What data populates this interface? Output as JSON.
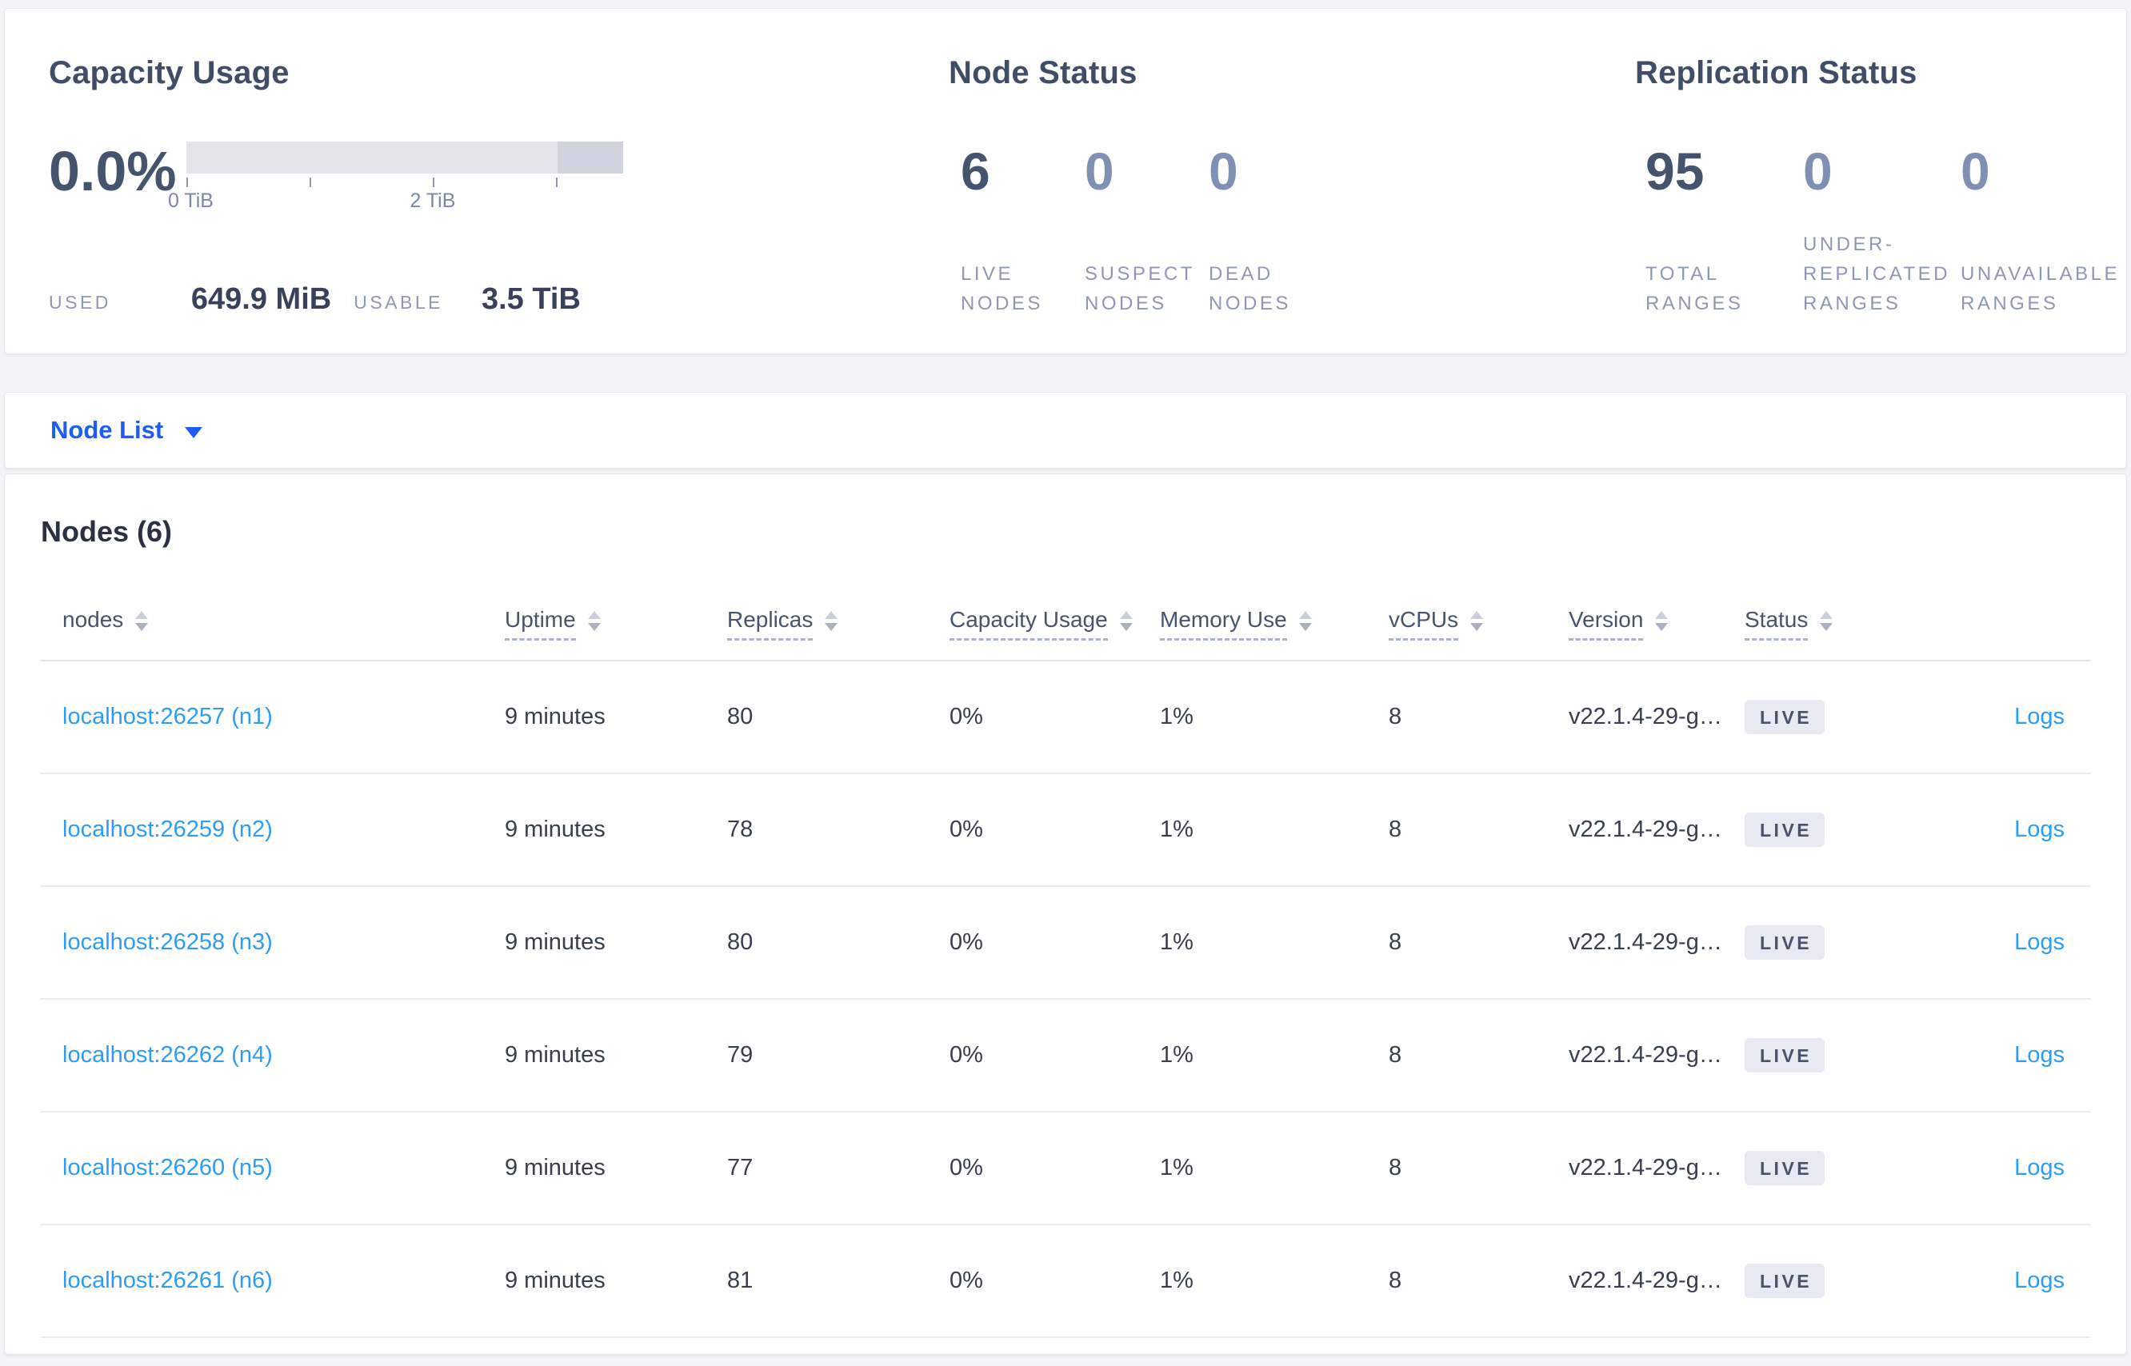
{
  "summary": {
    "capacity": {
      "title": "Capacity Usage",
      "percent": "0.0%",
      "tick_labels": [
        "0 TiB",
        "2 TiB"
      ],
      "used_label": "USED",
      "used_value": "649.9 MiB",
      "usable_label": "USABLE",
      "usable_value": "3.5 TiB"
    },
    "node_status": {
      "title": "Node Status",
      "metrics": [
        {
          "value": "6",
          "label": "LIVE NODES",
          "muted": false
        },
        {
          "value": "0",
          "label": "SUSPECT NODES",
          "muted": true
        },
        {
          "value": "0",
          "label": "DEAD NODES",
          "muted": true
        }
      ]
    },
    "replication_status": {
      "title": "Replication Status",
      "metrics": [
        {
          "value": "95",
          "label": "TOTAL RANGES",
          "muted": false
        },
        {
          "value": "0",
          "label": "UNDER-REPLICATED RANGES",
          "muted": true
        },
        {
          "value": "0",
          "label": "UNAVAILABLE RANGES",
          "muted": true
        }
      ]
    }
  },
  "view_selector": {
    "label": "Node List"
  },
  "nodes_table": {
    "title": "Nodes (6)",
    "columns": [
      {
        "label": "nodes",
        "underlined": false
      },
      {
        "label": "Uptime",
        "underlined": true
      },
      {
        "label": "Replicas",
        "underlined": true
      },
      {
        "label": "Capacity Usage",
        "underlined": true
      },
      {
        "label": "Memory Use",
        "underlined": true
      },
      {
        "label": "vCPUs",
        "underlined": true
      },
      {
        "label": "Version",
        "underlined": true
      },
      {
        "label": "Status",
        "underlined": true
      }
    ],
    "logs_label": "Logs",
    "rows": [
      {
        "address": "localhost:26257 (n1)",
        "uptime": "9 minutes",
        "replicas": "80",
        "capacity_usage": "0%",
        "memory_use": "1%",
        "vcpus": "8",
        "version": "v22.1.4-29-g…",
        "status": "LIVE"
      },
      {
        "address": "localhost:26259 (n2)",
        "uptime": "9 minutes",
        "replicas": "78",
        "capacity_usage": "0%",
        "memory_use": "1%",
        "vcpus": "8",
        "version": "v22.1.4-29-g…",
        "status": "LIVE"
      },
      {
        "address": "localhost:26258 (n3)",
        "uptime": "9 minutes",
        "replicas": "80",
        "capacity_usage": "0%",
        "memory_use": "1%",
        "vcpus": "8",
        "version": "v22.1.4-29-g…",
        "status": "LIVE"
      },
      {
        "address": "localhost:26262 (n4)",
        "uptime": "9 minutes",
        "replicas": "79",
        "capacity_usage": "0%",
        "memory_use": "1%",
        "vcpus": "8",
        "version": "v22.1.4-29-g…",
        "status": "LIVE"
      },
      {
        "address": "localhost:26260 (n5)",
        "uptime": "9 minutes",
        "replicas": "77",
        "capacity_usage": "0%",
        "memory_use": "1%",
        "vcpus": "8",
        "version": "v22.1.4-29-g…",
        "status": "LIVE"
      },
      {
        "address": "localhost:26261 (n6)",
        "uptime": "9 minutes",
        "replicas": "81",
        "capacity_usage": "0%",
        "memory_use": "1%",
        "vcpus": "8",
        "version": "v22.1.4-29-g…",
        "status": "LIVE"
      }
    ]
  },
  "colors": {
    "accent_link_blue": "#1d5cf6",
    "row_link_blue": "#2f9cf4",
    "slate_heading": "#45546e",
    "muted_metric": "#8090b5",
    "badge_bg": "#e7eaf2",
    "bar_light": "#e3e5ed",
    "bar_dark": "#cfd3de",
    "page_bg": "#f3f4f8"
  }
}
